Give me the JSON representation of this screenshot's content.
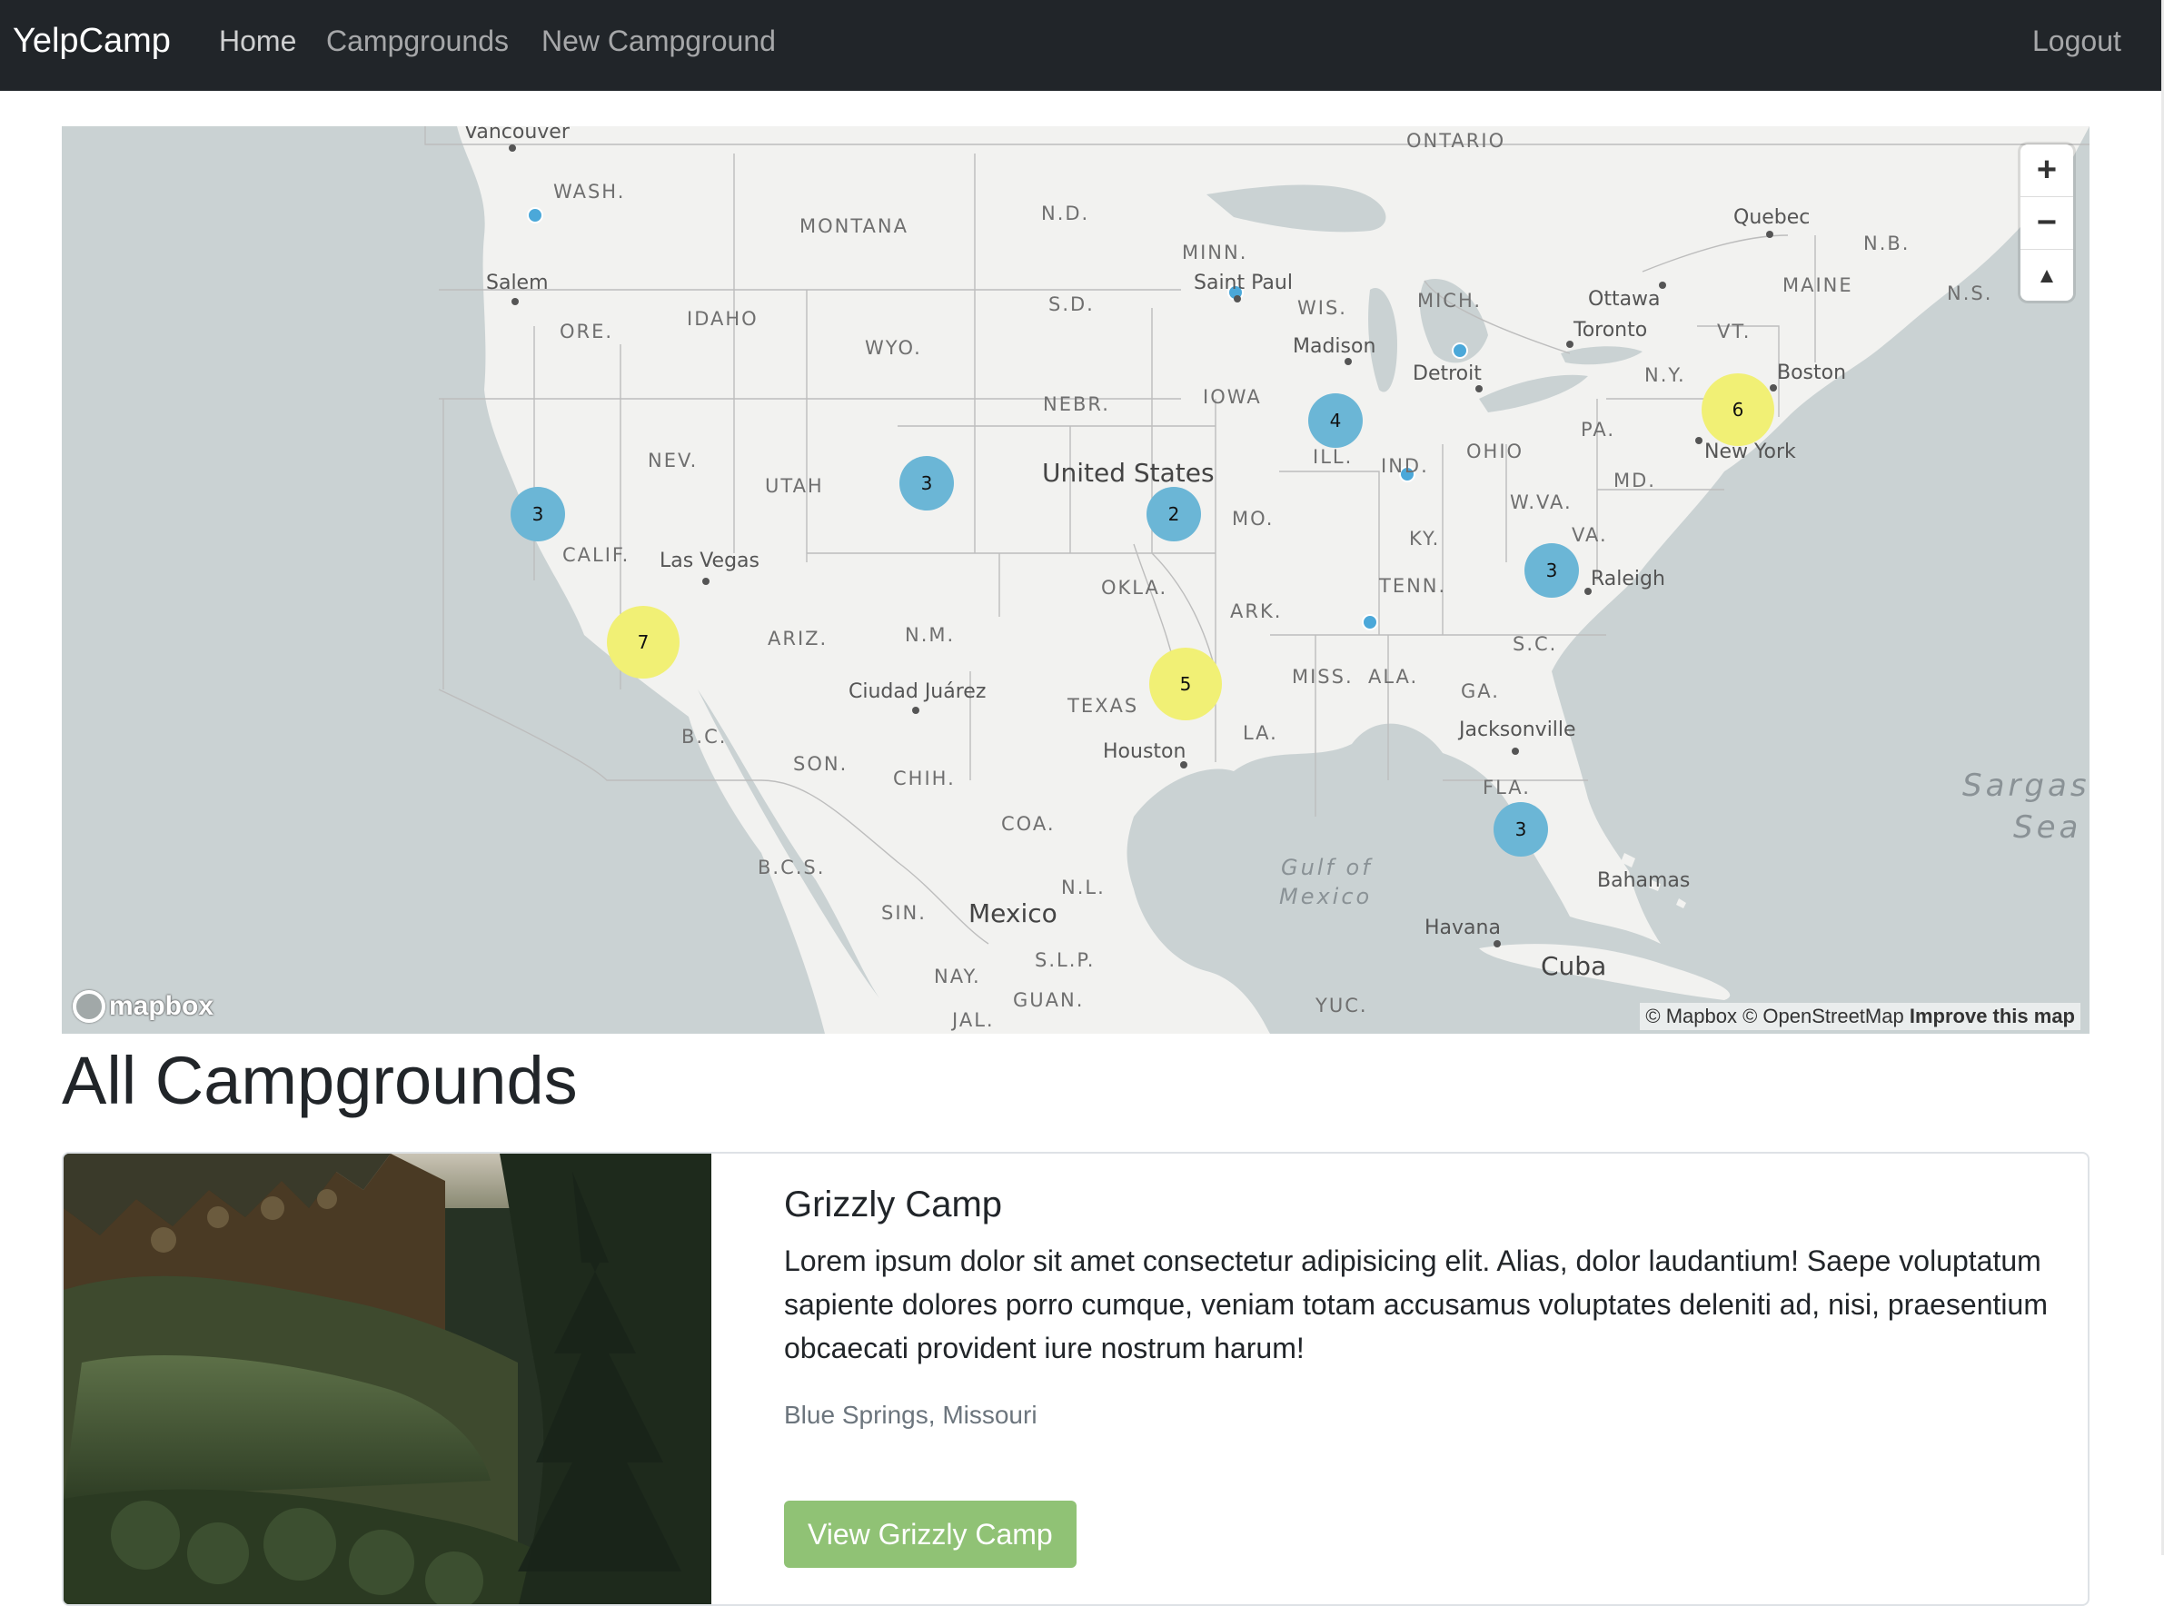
{
  "nav": {
    "brand": "YelpCamp",
    "links": [
      "Home",
      "Campgrounds",
      "New Campground"
    ],
    "logout": "Logout"
  },
  "map": {
    "labels": {
      "vancouver": "Vancouver",
      "ontario": "ONTARIO",
      "wash": "WASH.",
      "montana": "MONTANA",
      "nd": "N.D.",
      "minn": "MINN.",
      "quebec": "Quebec",
      "nb": "N.B.",
      "ns": "N.S.",
      "salem": "Salem",
      "saint_paul": "Saint Paul",
      "wis": "WIS.",
      "mich": "MICH.",
      "ottawa": "Ottawa",
      "maine": "MAINE",
      "ore": "ORE.",
      "idaho": "IDAHO",
      "sd": "S.D.",
      "wyo": "WYO.",
      "madison": "Madison",
      "toronto": "Toronto",
      "vt": "VT.",
      "detroit": "Detroit",
      "ny": "N.Y.",
      "boston": "Boston",
      "nebr": "NEBR.",
      "iowa": "IOWA",
      "pa": "PA.",
      "nev": "NEV.",
      "ill": "ILL.",
      "ohio": "OHIO",
      "new_york": "New York",
      "utah": "UTAH",
      "united_states": "United States",
      "ind": "IND.",
      "md": "MD.",
      "mo": "MO.",
      "wva": "W.VA.",
      "calif": "CALIF.",
      "las_vegas": "Las Vegas",
      "ky": "KY.",
      "va": "VA.",
      "raleigh": "Raleigh",
      "okla": "OKLA.",
      "tenn": "TENN.",
      "ark": "ARK.",
      "ariz": "ARIZ.",
      "nm": "N.M.",
      "sc": "S.C.",
      "miss": "MISS.",
      "ala": "ALA.",
      "ga": "GA.",
      "ciudad_juarez": "Ciudad Juárez",
      "texas": "TEXAS",
      "bc": "B.C.",
      "la": "LA.",
      "houston": "Houston",
      "jacksonville": "Jacksonville",
      "son": "SON.",
      "chih": "CHIH.",
      "fla": "FLA.",
      "sargasso": "Sargass",
      "sea": "Sea",
      "coa": "COA.",
      "bcs": "B.C.S.",
      "gulf_of": "Gulf of",
      "mexico_water": "Mexico",
      "bahamas": "Bahamas",
      "nl": "N.L.",
      "sin": "SIN.",
      "mexico": "Mexico",
      "havana": "Havana",
      "slp": "S.L.P.",
      "cuba": "Cuba",
      "nay": "NAY.",
      "guan": "GUAN.",
      "yuc": "YUC.",
      "jal": "JAL."
    },
    "clusters": [
      {
        "count": "3",
        "color": "#6bb6d6"
      },
      {
        "count": "7",
        "color": "#f1f075"
      },
      {
        "count": "3",
        "color": "#6bb6d6"
      },
      {
        "count": "2",
        "color": "#6bb6d6"
      },
      {
        "count": "5",
        "color": "#f1f075"
      },
      {
        "count": "4",
        "color": "#6bb6d6"
      },
      {
        "count": "6",
        "color": "#f1f075"
      },
      {
        "count": "3",
        "color": "#6bb6d6"
      },
      {
        "count": "3",
        "color": "#6bb6d6"
      }
    ],
    "zoom_in": "+",
    "zoom_out": "−",
    "compass": "▲",
    "attribution": "© Mapbox © OpenStreetMap",
    "improve": "Improve this map",
    "logo": "mapbox"
  },
  "heading": "All Campgrounds",
  "campground": {
    "title": "Grizzly Camp",
    "description": "Lorem ipsum dolor sit amet consectetur adipisicing elit. Alias, dolor laudantium! Saepe voluptatum sapiente dolores porro cumque, veniam totam accusamus voluptates deleniti ad, nisi, praesentium obcaecati provident iure nostrum harum!",
    "location": "Blue Springs, Missouri",
    "button": "View Grizzly Camp"
  },
  "colors": {
    "navbar": "#212529",
    "cluster_small": "#6bb6d6",
    "cluster_large": "#f1f075",
    "point": "#4ba8d9",
    "button": "#90c275",
    "water": "#cad2d3",
    "land": "#f2f2f0"
  }
}
